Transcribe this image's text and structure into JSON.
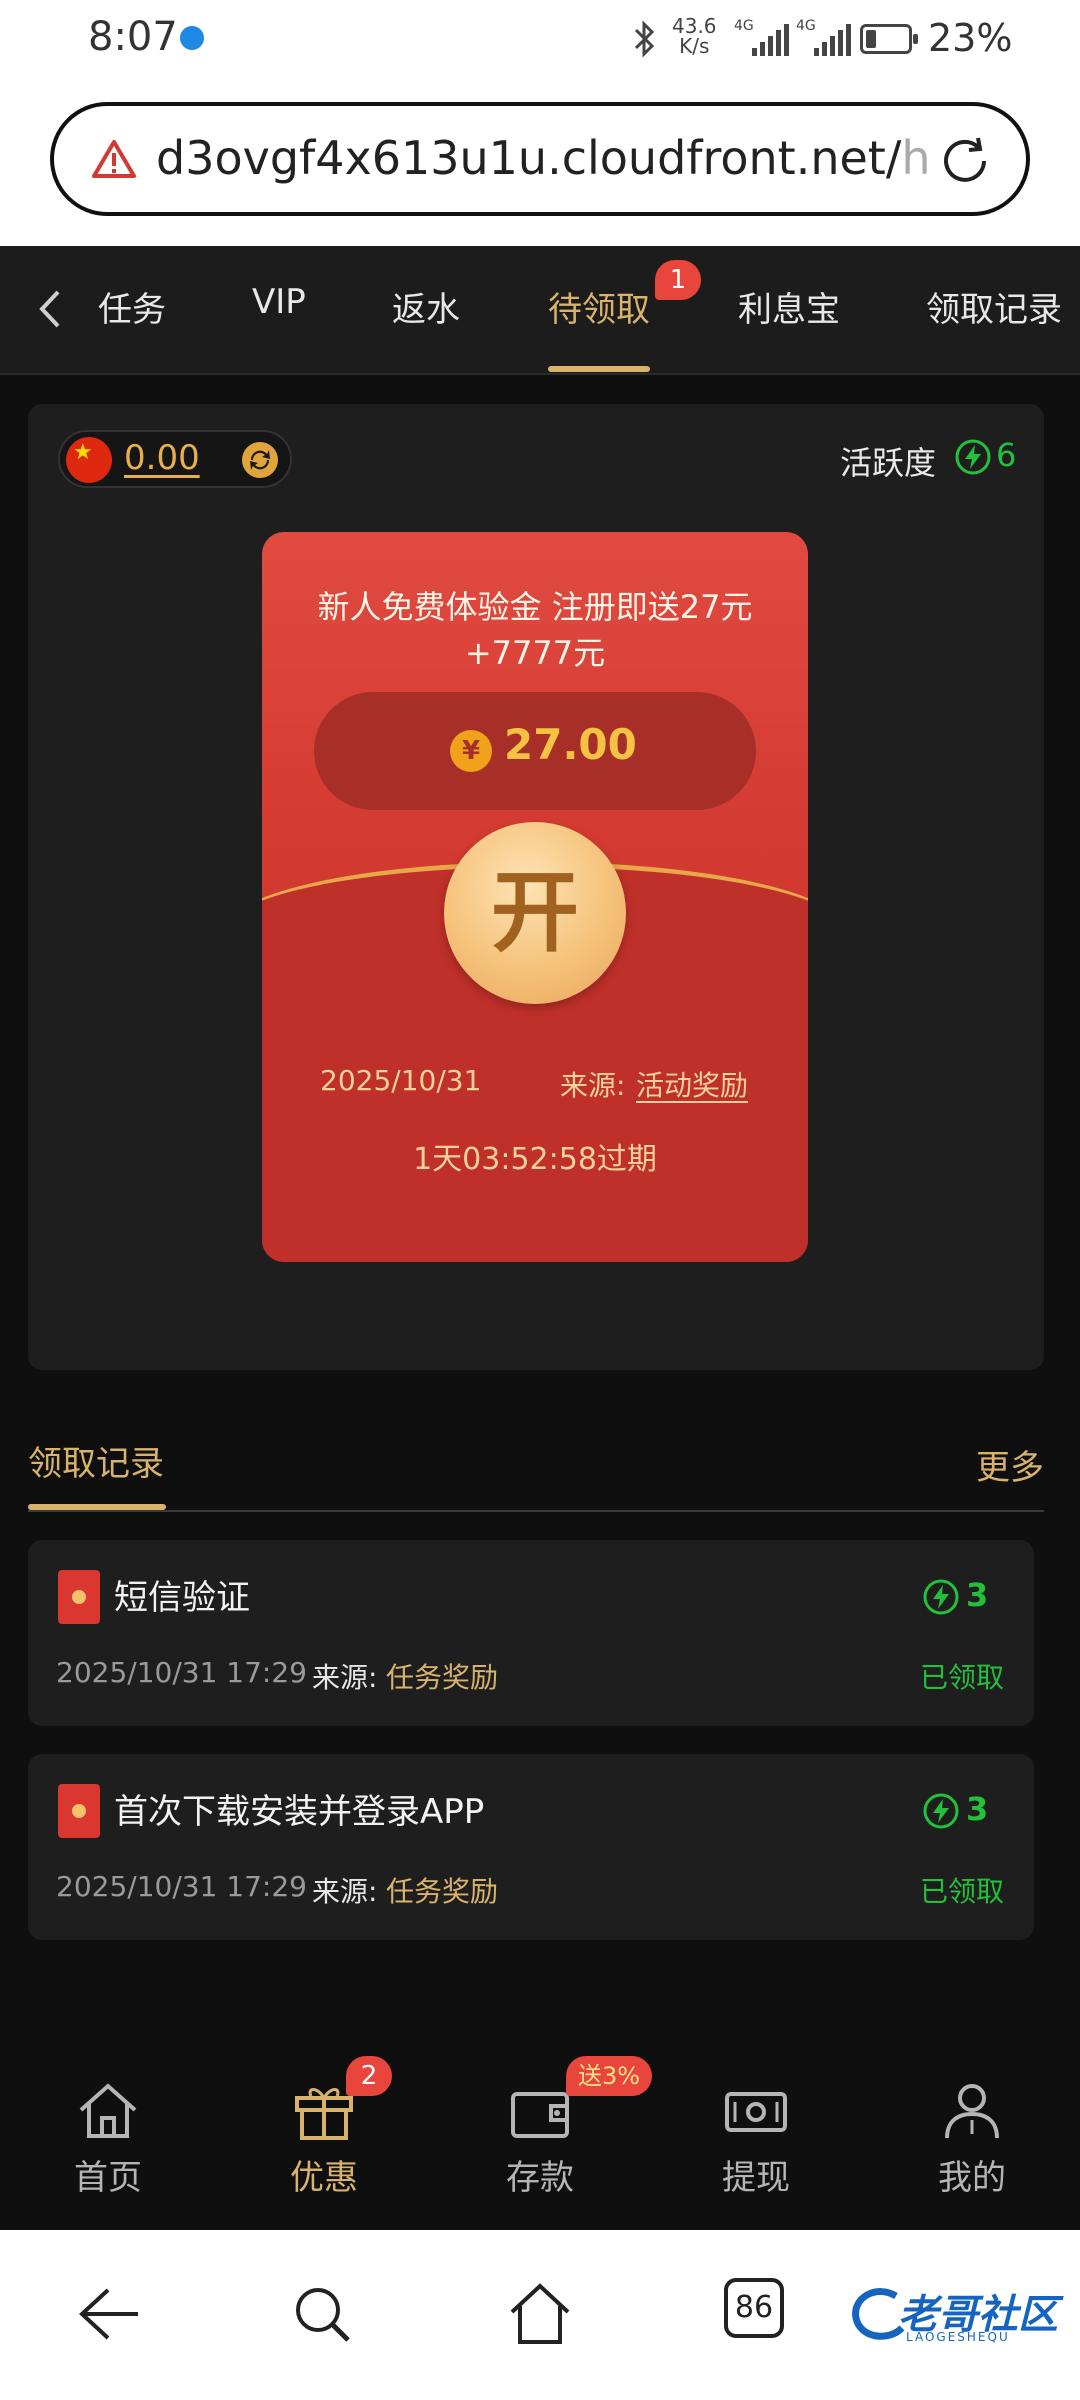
{
  "status_bar": {
    "time": "8:07",
    "net_speed_value": "43.6",
    "net_speed_unit": "K/s",
    "sim1_label": "4G",
    "sim2_label": "4G",
    "battery_percent": "23%"
  },
  "browser": {
    "url": "d3ovgf4x613u1u.cloudfront.net/",
    "url_tail": "h"
  },
  "tabs": [
    {
      "label": "任务"
    },
    {
      "label": "VIP"
    },
    {
      "label": "返水"
    },
    {
      "label": "待领取",
      "active": true,
      "badge": "1"
    },
    {
      "label": "利息宝"
    },
    {
      "label": "领取记录"
    }
  ],
  "main": {
    "balance": "0.00",
    "activity_label": "活跃度",
    "activity_value": "6"
  },
  "envelope": {
    "title": "新人免费体验金 注册即送27元+7777元",
    "currency_symbol": "¥",
    "amount": "27.00",
    "open_label": "开",
    "date": "2025/10/31",
    "source_label": "来源:",
    "source": "活动奖励",
    "expiry": "1天03:52:58过期"
  },
  "records": {
    "title": "领取记录",
    "more": "更多",
    "items": [
      {
        "title": "短信验证",
        "points": "3",
        "date": "2025/10/31 17:29",
        "source_label": "来源:",
        "source": "任务奖励",
        "status": "已领取"
      },
      {
        "title": "首次下载安装并登录APP",
        "points": "3",
        "date": "2025/10/31 17:29",
        "source_label": "来源:",
        "source": "任务奖励",
        "status": "已领取"
      }
    ]
  },
  "app_nav": {
    "items": [
      {
        "label": "首页",
        "icon": "home-icon"
      },
      {
        "label": "优惠",
        "icon": "gift-icon",
        "active": true,
        "badge": "2"
      },
      {
        "label": "存款",
        "icon": "wallet-icon",
        "badge": "送3%"
      },
      {
        "label": "提现",
        "icon": "cash-icon"
      },
      {
        "label": "我的",
        "icon": "user-icon"
      }
    ]
  },
  "system_nav": {
    "tab_count": "86",
    "watermark": "老哥社区",
    "watermark_sub": "LAOGESHEQU"
  },
  "colors": {
    "accent_gold": "#d9b36c",
    "green": "#22c03b",
    "envelope_red": "#d23a31",
    "badge_red": "#e8453c"
  }
}
